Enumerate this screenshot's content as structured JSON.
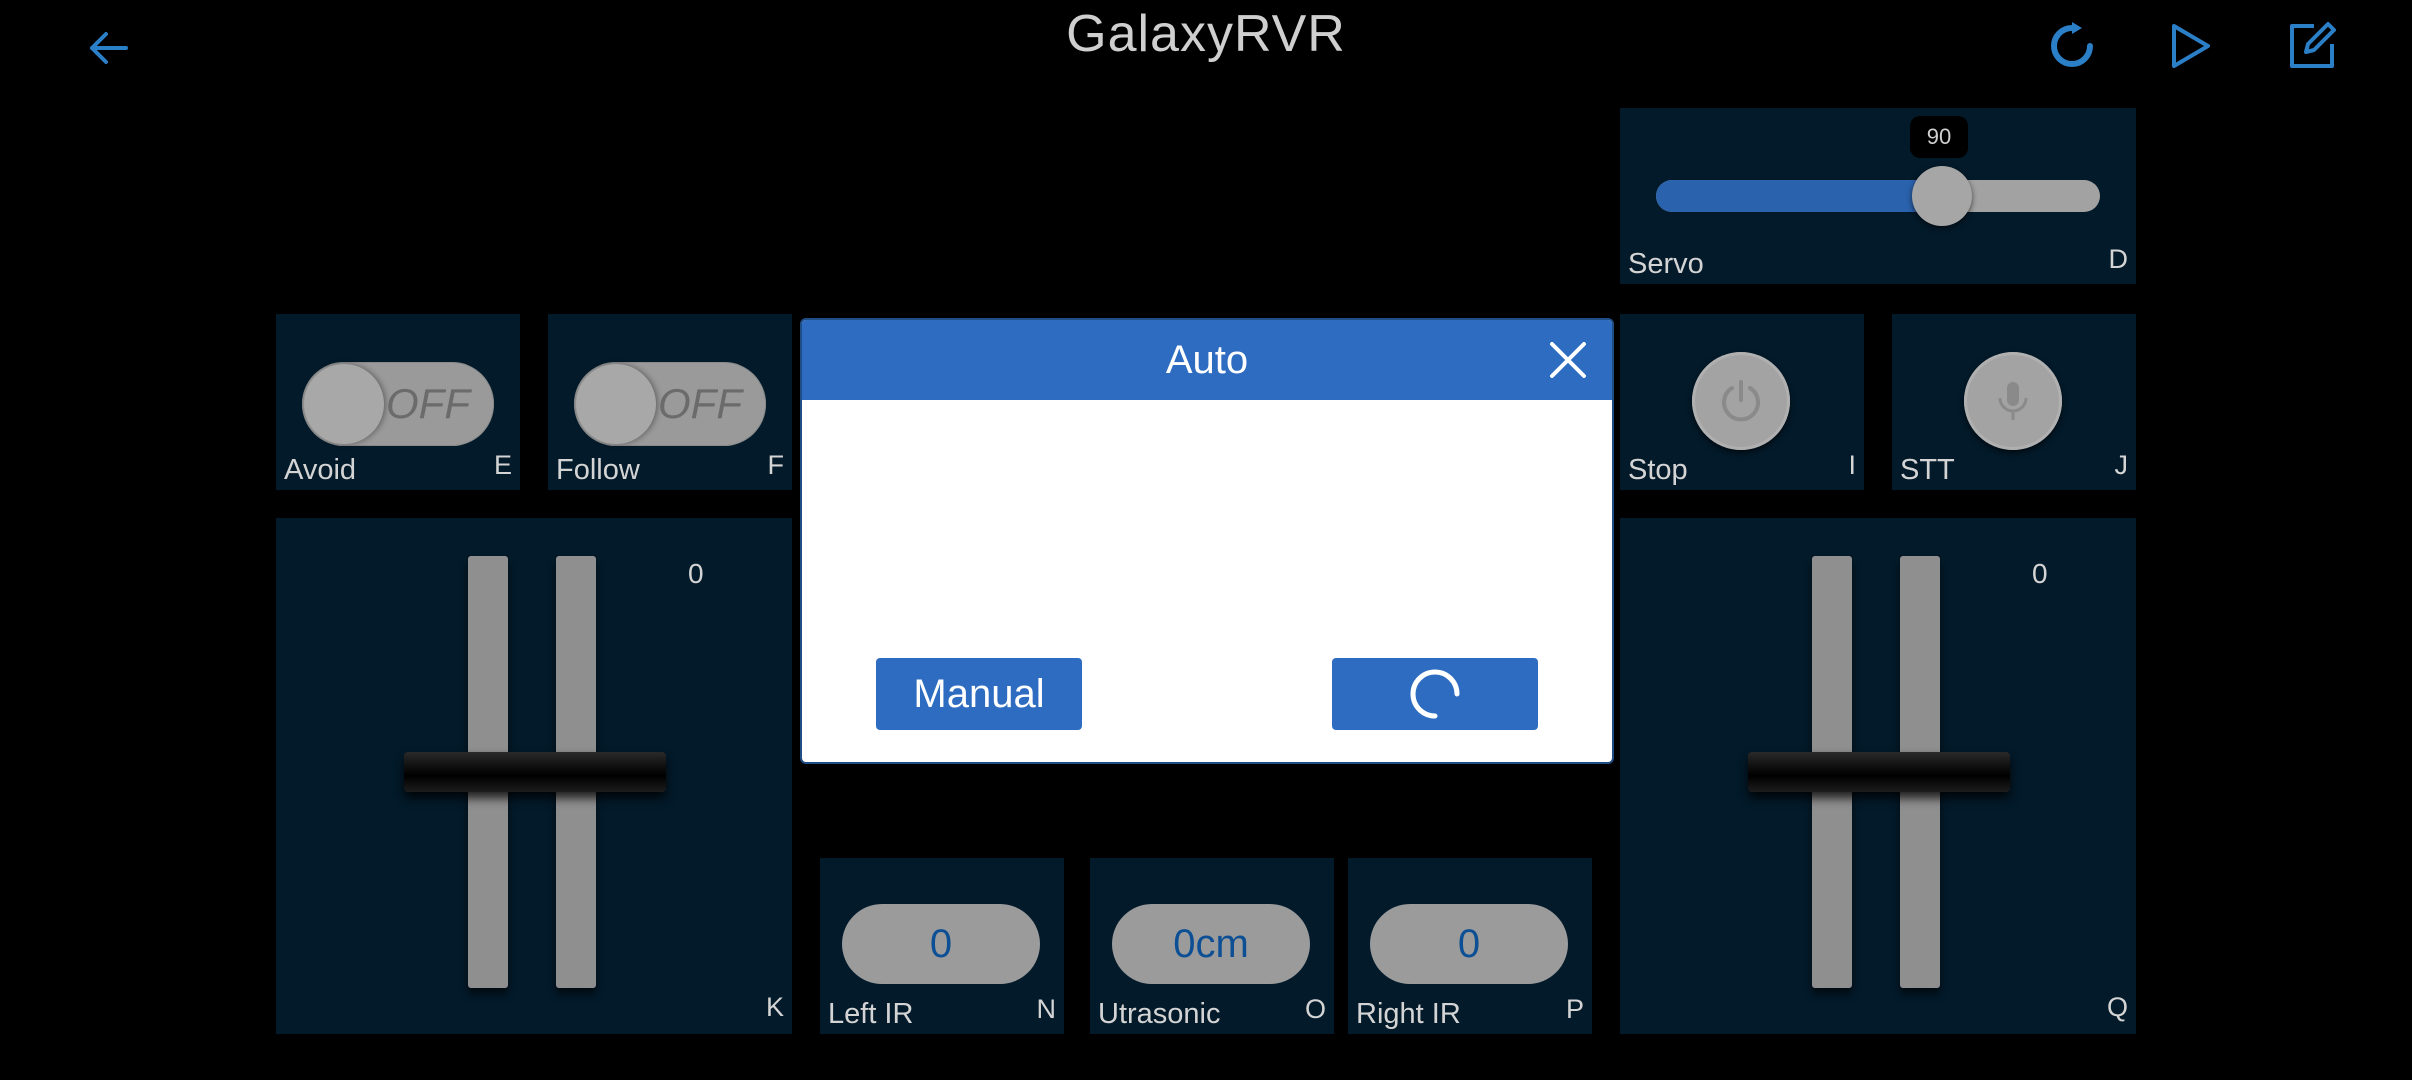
{
  "header": {
    "title": "GalaxyRVR",
    "back_icon": "arrow-left-icon",
    "refresh_icon": "refresh-icon",
    "play_icon": "play-icon",
    "edit_icon": "edit-icon",
    "accent_color": "#2b7fc7"
  },
  "servo": {
    "label": "Servo",
    "key": "D",
    "value": "90",
    "fraction": 0.65
  },
  "avoid": {
    "label": "Avoid",
    "key": "E",
    "state": "OFF"
  },
  "follow": {
    "label": "Follow",
    "key": "F",
    "state": "OFF"
  },
  "stop": {
    "label": "Stop",
    "key": "I",
    "icon": "power-icon"
  },
  "stt": {
    "label": "STT",
    "key": "J",
    "icon": "microphone-icon"
  },
  "left_throttle": {
    "value": "0",
    "key": "K"
  },
  "right_throttle": {
    "value": "0",
    "key": "Q"
  },
  "left_ir": {
    "label": "Left IR",
    "key": "N",
    "value": "0"
  },
  "ultrasonic": {
    "label": "Utrasonic",
    "key": "O",
    "value": "0cm"
  },
  "right_ir": {
    "label": "Right IR",
    "key": "P",
    "value": "0"
  },
  "modal": {
    "title": "Auto",
    "close_icon": "close-icon",
    "manual_label": "Manual",
    "loading_icon": "loading-spinner-icon",
    "header_color": "#2d6cc0"
  }
}
